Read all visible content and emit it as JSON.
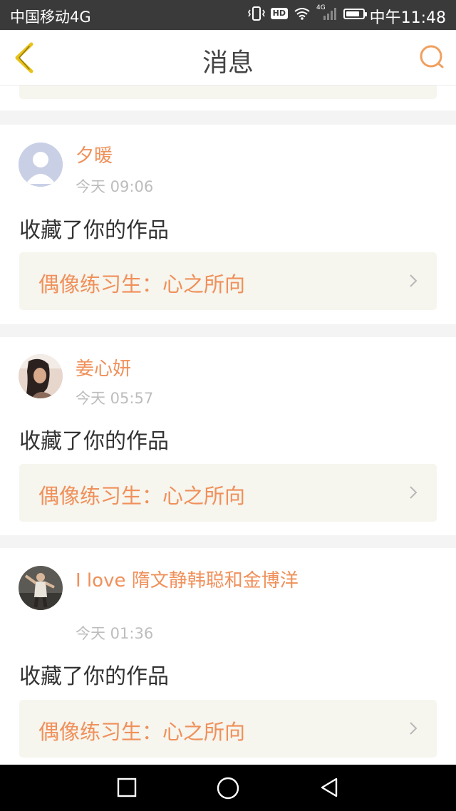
{
  "status_bar": {
    "carrier": "中国移动4G",
    "hd": "HD",
    "signal_type": "4G",
    "time": "中午11:48",
    "battery_level": 0.85
  },
  "header": {
    "title": "消息",
    "back_icon": "chevron-left-icon",
    "search_icon": "search-icon"
  },
  "colors": {
    "accent": "#f0905a",
    "back_yellow": "#e8c21a",
    "work_link_bg": "#f6f5ee"
  },
  "messages": [
    {
      "username": "夕暖",
      "time": "今天 09:06",
      "action": "收藏了你的作品",
      "work_title": "偶像练习生：心之所向",
      "avatar": "default-avatar"
    },
    {
      "username": "姜心妍",
      "time": "今天 05:57",
      "action": "收藏了你的作品",
      "work_title": "偶像练习生：心之所向",
      "avatar": "photo-avatar"
    },
    {
      "username": "I love 隋文静韩聪和金博洋",
      "time": "今天 01:36",
      "action": "收藏了你的作品",
      "work_title": "偶像练习生：心之所向",
      "avatar": "photo-avatar"
    }
  ],
  "system_nav": {
    "recents_icon": "square-icon",
    "home_icon": "circle-icon",
    "back_icon": "triangle-back-icon"
  }
}
